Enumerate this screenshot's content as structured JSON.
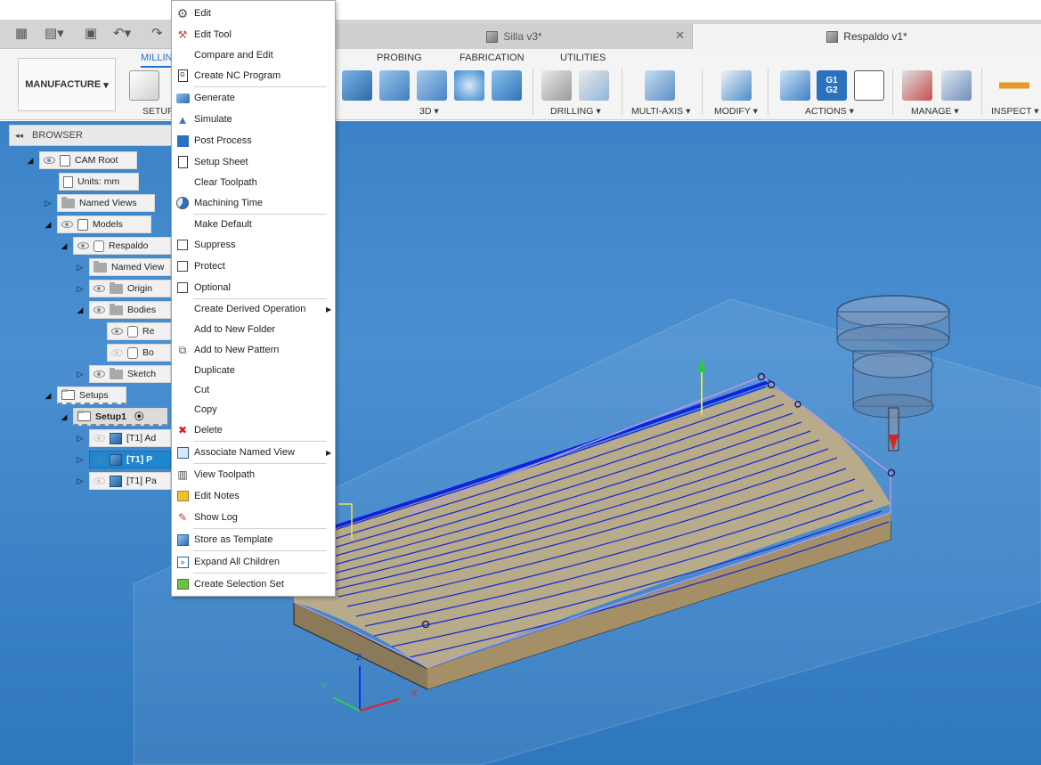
{
  "colors": {
    "accent": "#1a76c8",
    "selection": "#1f86cf",
    "viewport": "#3d84c9",
    "toolpath": "#1b2ed1",
    "stock": "#8a7a5a"
  },
  "tabs": {
    "document1": "Silla v3*",
    "document2": "Respaldo v1*"
  },
  "ribbon": {
    "workspace": "MANUFACTURE",
    "tabs": {
      "milling": "MILLING",
      "probing": "PROBING",
      "fabrication": "FABRICATION",
      "utilities": "UTILITIES"
    },
    "groups": {
      "setup": "SETUP",
      "d3": "3D",
      "drilling": "DRILLING",
      "multiaxis": "MULTI-AXIS",
      "modify": "MODIFY",
      "actions": "ACTIONS",
      "manage": "MANAGE",
      "inspect": "INSPECT"
    },
    "g1g2": [
      "G1",
      "G2"
    ]
  },
  "browser": {
    "title": "BROWSER",
    "nodes": {
      "cam_root": "CAM Root",
      "units": "Units: mm",
      "named_views": "Named Views",
      "models": "Models",
      "respaldo": "Respaldo",
      "named_view_sub": "Named View",
      "origin": "Origin",
      "bodies": "Bodies",
      "body1": "Re",
      "body2": "Bo",
      "sketches": "Sketch",
      "setups": "Setups",
      "setup1": "Setup1",
      "op1": "[T1] Ad",
      "op2": "[T1] P",
      "op3": "[T1] Pa"
    }
  },
  "menu": {
    "items": [
      {
        "label": "Edit",
        "icon": "gear-icon"
      },
      {
        "label": "Edit Tool",
        "icon": "tool-icon"
      },
      {
        "label": "Compare and Edit",
        "icon": ""
      },
      {
        "label": "Create NC Program",
        "icon": "nc-program-icon"
      },
      {
        "label": "Generate",
        "icon": "generate-icon"
      },
      {
        "label": "Simulate",
        "icon": "simulate-icon"
      },
      {
        "label": "Post Process",
        "icon": "post-process-icon"
      },
      {
        "label": "Setup Sheet",
        "icon": "setup-sheet-icon"
      },
      {
        "label": "Clear Toolpath",
        "icon": ""
      },
      {
        "label": "Machining Time",
        "icon": "clock-icon"
      },
      {
        "label": "Make Default",
        "icon": ""
      },
      {
        "label": "Suppress",
        "icon": "checkbox-icon"
      },
      {
        "label": "Protect",
        "icon": "checkbox-icon"
      },
      {
        "label": "Optional",
        "icon": "checkbox-icon"
      },
      {
        "label": "Create Derived Operation",
        "icon": "",
        "submenu": true
      },
      {
        "label": "Add to New Folder",
        "icon": ""
      },
      {
        "label": "Add to New Pattern",
        "icon": "pattern-icon"
      },
      {
        "label": "Duplicate",
        "icon": ""
      },
      {
        "label": "Cut",
        "icon": ""
      },
      {
        "label": "Copy",
        "icon": ""
      },
      {
        "label": "Delete",
        "icon": "delete-icon"
      },
      {
        "label": "Associate Named View",
        "icon": "named-view-icon",
        "submenu": true
      },
      {
        "label": "View Toolpath",
        "icon": "view-toolpath-icon"
      },
      {
        "label": "Edit Notes",
        "icon": "notes-icon"
      },
      {
        "label": "Show Log",
        "icon": "log-icon"
      },
      {
        "label": "Store as Template",
        "icon": "template-icon"
      },
      {
        "label": "Expand All Children",
        "icon": "expand-icon"
      },
      {
        "label": "Create Selection Set",
        "icon": "selection-set-icon"
      }
    ]
  },
  "triad": {
    "z": "Z",
    "y": "Y",
    "x": "X"
  }
}
